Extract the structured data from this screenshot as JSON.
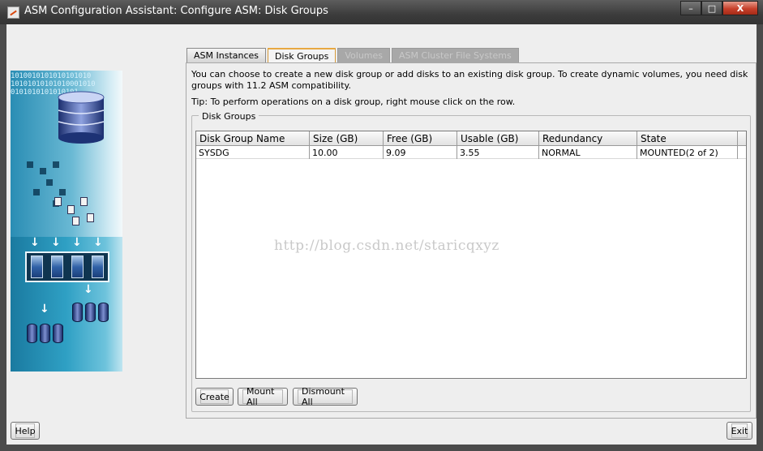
{
  "window": {
    "title": "ASM Configuration Assistant: Configure ASM: Disk Groups",
    "minimize": "–",
    "maximize": "□",
    "close": "X"
  },
  "banner": {
    "bits": [
      "1010010101010101010",
      "10101010101010001010",
      "0101010101010101"
    ]
  },
  "tabs": [
    {
      "label": "ASM Instances",
      "state": "normal"
    },
    {
      "label": "Disk Groups",
      "state": "active"
    },
    {
      "label": "Volumes",
      "state": "disabled"
    },
    {
      "label": "ASM Cluster File Systems",
      "state": "disabled"
    }
  ],
  "panel": {
    "description": "You can choose to create a new disk group or add disks to an existing disk group. To create dynamic volumes, you need disk groups with 11.2 ASM compatibility.",
    "tip": "Tip: To perform operations on a disk group, right mouse click on the row.",
    "group_label": "Disk Groups"
  },
  "table": {
    "columns": [
      "Disk Group Name",
      "Size (GB)",
      "Free (GB)",
      "Usable (GB)",
      "Redundancy",
      "State"
    ],
    "rows": [
      [
        "SYSDG",
        "10.00",
        "9.09",
        "3.55",
        "NORMAL",
        "MOUNTED(2 of 2)"
      ]
    ]
  },
  "watermark": "http://blog.csdn.net/staricqxyz",
  "buttons": {
    "create": "Create",
    "mount_all": "Mount All",
    "dismount_all": "Dismount All",
    "help": "Help",
    "exit": "Exit"
  },
  "colors": {
    "active_tab_border": "#e8a842",
    "close_button": "#c7402b",
    "banner_blue": "#2fa0c4"
  }
}
